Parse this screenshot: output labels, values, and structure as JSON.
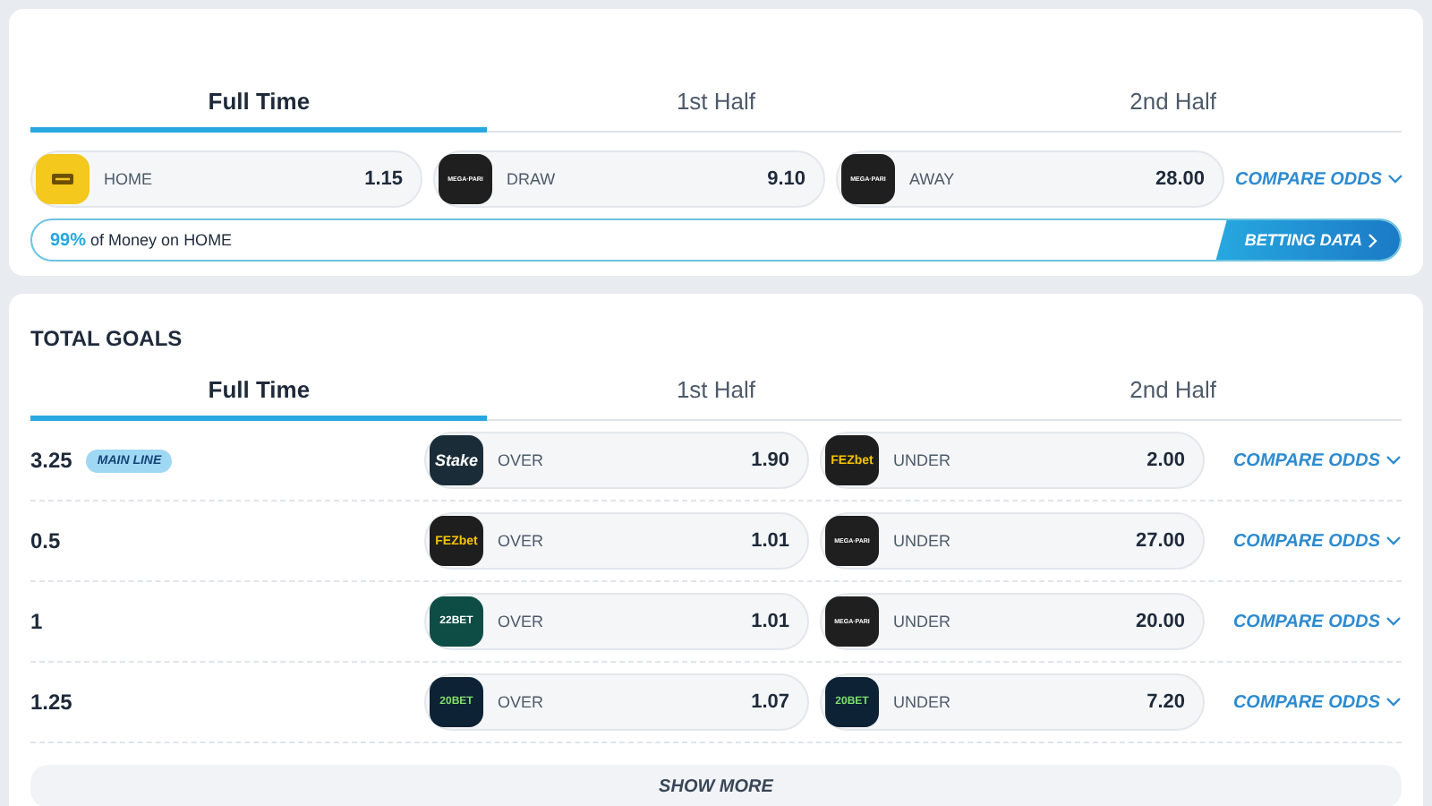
{
  "result_card": {
    "tabs": [
      {
        "label": "Full Time",
        "selected": true
      },
      {
        "label": "1st Half",
        "selected": false
      },
      {
        "label": "2nd Half",
        "selected": false
      }
    ],
    "odds": [
      {
        "kind": "yellow",
        "label": "HOME",
        "value": "1.15"
      },
      {
        "kind": "megapari",
        "logo": "MEGA·PARI",
        "label": "DRAW",
        "value": "9.10"
      },
      {
        "kind": "megapari",
        "logo": "MEGA·PARI",
        "label": "AWAY",
        "value": "28.00"
      }
    ],
    "compare": "COMPARE ODDS",
    "money": {
      "percent": "99%",
      "text": "of Money on HOME",
      "button": "BETTING DATA"
    }
  },
  "total_goals": {
    "title": "TOTAL GOALS",
    "tabs": [
      {
        "label": "Full Time",
        "selected": true
      },
      {
        "label": "1st Half",
        "selected": false
      },
      {
        "label": "2nd Half",
        "selected": false
      }
    ],
    "rows": [
      {
        "line": "3.25",
        "badge": "MAIN LINE",
        "over": {
          "kind": "stake",
          "logo": "Stake",
          "label": "OVER",
          "value": "1.90"
        },
        "under": {
          "kind": "fezbet",
          "logo": "FEZbet",
          "label": "UNDER",
          "value": "2.00"
        },
        "compare": "COMPARE ODDS"
      },
      {
        "line": "0.5",
        "over": {
          "kind": "fezbet",
          "logo": "FEZbet",
          "label": "OVER",
          "value": "1.01"
        },
        "under": {
          "kind": "megapari",
          "logo": "MEGA·PARI",
          "label": "UNDER",
          "value": "27.00"
        },
        "compare": "COMPARE ODDS"
      },
      {
        "line": "1",
        "over": {
          "kind": "twentytwo",
          "logo": "22BET",
          "label": "OVER",
          "value": "1.01"
        },
        "under": {
          "kind": "megapari",
          "logo": "MEGA·PARI",
          "label": "UNDER",
          "value": "20.00"
        },
        "compare": "COMPARE ODDS"
      },
      {
        "line": "1.25",
        "over": {
          "kind": "twenty",
          "logo": "20BET",
          "label": "OVER",
          "value": "1.07"
        },
        "under": {
          "kind": "twenty",
          "logo": "20BET",
          "label": "UNDER",
          "value": "7.20"
        },
        "compare": "COMPARE ODDS"
      }
    ],
    "show_more": "SHOW MORE"
  }
}
